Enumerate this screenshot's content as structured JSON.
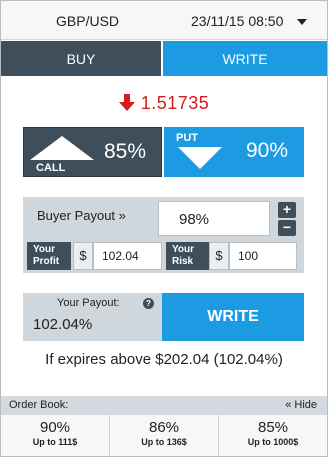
{
  "header": {
    "pair": "GBP/USD",
    "expiry": "23/11/15 08:50"
  },
  "tabs": {
    "buy": "BUY",
    "write": "WRITE"
  },
  "price": {
    "value": "1.51735",
    "direction": "down",
    "color": "#d71a1a"
  },
  "options": {
    "call": {
      "label": "CALL",
      "percent": "85%",
      "icon": "up-triangle-icon"
    },
    "put": {
      "label": "PUT",
      "percent": "90%",
      "icon": "down-triangle-icon"
    }
  },
  "buyer_payout": {
    "label": "Buyer Payout »",
    "value": "98%",
    "plus": "+",
    "minus": "−"
  },
  "profit": {
    "label_line1": "Your",
    "label_line2": "Profit",
    "currency": "$",
    "value": "102.04"
  },
  "risk": {
    "label_line1": "Your",
    "label_line2": "Risk",
    "currency": "$",
    "value": "100"
  },
  "your_payout": {
    "label": "Your Payout:",
    "value": "102.04%",
    "info": "?"
  },
  "write_button": "WRITE",
  "expires_text": "If expires above $202.04 (102.04%)",
  "order_book": {
    "title": "Order Book:",
    "hide": "« Hide",
    "entries": [
      {
        "percent": "90%",
        "sub": "Up to 111$"
      },
      {
        "percent": "86%",
        "sub": "Up to 136$"
      },
      {
        "percent": "85%",
        "sub": "Up to 1000$"
      }
    ]
  },
  "colors": {
    "dark": "#3e4e5a",
    "accent": "#1c9be3",
    "panel": "#cfd6dc"
  }
}
